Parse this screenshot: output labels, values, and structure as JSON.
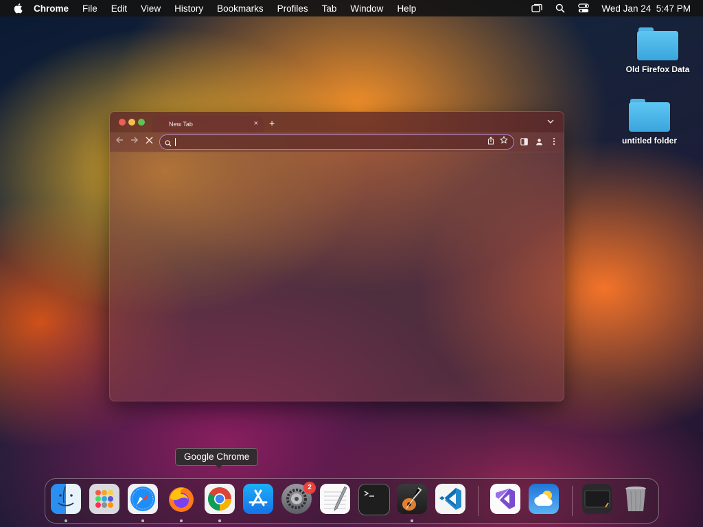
{
  "menubar": {
    "apple_icon": "apple-logo-icon",
    "app_name": "Chrome",
    "items": [
      "File",
      "Edit",
      "View",
      "History",
      "Bookmarks",
      "Profiles",
      "Tab",
      "Window",
      "Help"
    ],
    "status_icons": [
      "screen-mirroring-icon",
      "spotlight-search-icon",
      "control-center-icon"
    ],
    "clock": "Wed Jan 24  5:47 PM"
  },
  "desktop": {
    "icons": [
      {
        "label": "Old Firefox Data",
        "icon": "folder-icon"
      },
      {
        "label": "untitled folder",
        "icon": "folder-icon"
      }
    ]
  },
  "browser": {
    "tab_title": "New Tab",
    "tab_close": "×",
    "new_tab": "+",
    "tab_search": "⌄",
    "address_value": "",
    "colors": {
      "omnibox_focus": "#b58ad6"
    }
  },
  "dock": {
    "tooltip": "Google Chrome",
    "apps": [
      {
        "name": "Finder",
        "icon": "finder-icon",
        "running": true
      },
      {
        "name": "Launchpad",
        "icon": "launchpad-icon",
        "running": false
      },
      {
        "name": "Safari",
        "icon": "safari-icon",
        "running": true
      },
      {
        "name": "Firefox",
        "icon": "firefox-icon",
        "running": true
      },
      {
        "name": "Google Chrome",
        "icon": "chrome-icon",
        "running": true
      },
      {
        "name": "App Store",
        "icon": "app-store-icon",
        "running": false
      },
      {
        "name": "System Settings",
        "icon": "system-settings-icon",
        "running": false,
        "badge": "2"
      },
      {
        "name": "TextEdit",
        "icon": "textedit-icon",
        "running": false
      },
      {
        "name": "Terminal",
        "icon": "terminal-icon",
        "running": false
      },
      {
        "name": "GarageBand",
        "icon": "garageband-icon",
        "running": true
      },
      {
        "name": "Visual Studio Code",
        "icon": "vscode-icon",
        "running": false
      },
      {
        "name": "Visual Studio",
        "icon": "visual-studio-icon",
        "running": false
      },
      {
        "name": "Weather",
        "icon": "weather-icon",
        "running": false
      },
      {
        "name": "Screenshot",
        "icon": "screenshot-icon",
        "running": false
      },
      {
        "name": "Trash",
        "icon": "trash-icon",
        "running": false
      }
    ]
  }
}
